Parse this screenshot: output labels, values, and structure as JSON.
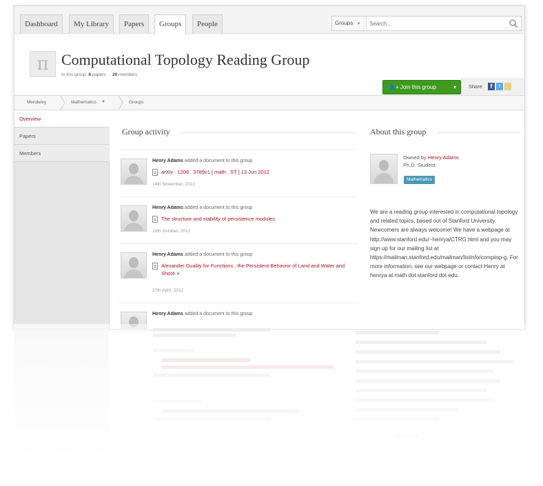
{
  "topnav": {
    "tabs": [
      "Dashboard",
      "My Library",
      "Papers",
      "Groups",
      "People"
    ],
    "active_tab": "Groups",
    "search_scope": "Groups",
    "search_placeholder": "Search..."
  },
  "header": {
    "logo_glyph": "π",
    "title": "Computational Topology Reading Group",
    "meta_prefix": "In this group:",
    "papers_count": "8",
    "papers_label": "papers",
    "members_count": "20",
    "members_label": "members",
    "join_label": "Join this group",
    "share_label": "Share",
    "facebook_glyph": "f",
    "twitter_glyph": "t"
  },
  "breadcrumb": [
    "Mendeley",
    "Mathematics",
    "Groups"
  ],
  "sidebar": {
    "items": [
      "Overview",
      "Papers",
      "Members"
    ],
    "active": "Overview"
  },
  "activity": {
    "title": "Group activity",
    "items": [
      {
        "user": "Henry Adams",
        "action": "added a document to this group",
        "doc": "arXiv : 1208 . 3789v1 [ math . ST ] 13 Jun 2012",
        "date": "14th November, 2012"
      },
      {
        "user": "Henry Adams",
        "action": "added a document to this group",
        "doc": "The structure and stability of persistence modules",
        "date": "16th October, 2012"
      },
      {
        "user": "Henry Adams",
        "action": "added a document to this group",
        "doc": "Alexander Duality for Functions : the Persistent Behavior of Land and Water and Shore +",
        "date": "27th April, 2012"
      },
      {
        "user": "Henry Adams",
        "action": "added a document to this group"
      }
    ]
  },
  "about": {
    "title": "About this group",
    "owned_by": "Owned by",
    "owner": "Henry Adams",
    "role": "Ph.D. Student",
    "tag": "Mathematics",
    "description": "We are a reading group interested in computational topology and related topics, based out of Stanford University. Newcomers are always welcome! We have a webpage at http://www.stanford.edu/~henrya/CTRG.html and you may sign up for our mailing list at https://mailman.stanford.edu/mailman/listinfo/comptop-g. For more information, see our webpage or contact Henry at henrya at math dot stanford dot edu."
  },
  "colors": {
    "accent_red": "#a5121f",
    "join_green": "#3d9a1f",
    "tag_blue": "#4a99b5",
    "facebook": "#3b5998",
    "twitter": "#55acee"
  }
}
